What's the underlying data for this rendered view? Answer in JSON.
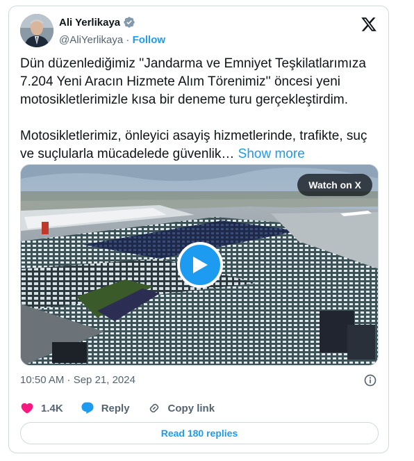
{
  "author": {
    "name": "Ali Yerlikaya",
    "handle": "@AliYerlikaya",
    "separator": " · ",
    "follow_label": "Follow"
  },
  "tweet": {
    "text": "Dün düzenlediğimiz ''Jandarma ve Emniyet Teşkilatlarımıza 7.204 Yeni Aracın Hizmete Alım Törenimiz'' öncesi yeni motosikletlerimizle kısa bir deneme turu gerçekleştirdim.\n\nMotosikletlerimiz, önleyici asayiş hizmetlerinde, trafikte, suç ve suçlularla mücadelede güvenlik… ",
    "show_more": "Show more"
  },
  "media": {
    "watch_label": "Watch on X"
  },
  "timestamp": "10:50 AM · Sep 21, 2024",
  "actions": {
    "likes": "1.4K",
    "reply": "Reply",
    "copy_link": "Copy link"
  },
  "read_replies": "Read 180 replies",
  "colors": {
    "accent": "#1d9bf0",
    "like": "#f91880",
    "text": "#0f1419",
    "muted": "#536471",
    "border": "#cfd9de"
  },
  "icons": [
    "verified-badge-icon",
    "x-logo-icon",
    "play-icon",
    "info-icon",
    "heart-icon",
    "reply-icon",
    "link-icon"
  ]
}
